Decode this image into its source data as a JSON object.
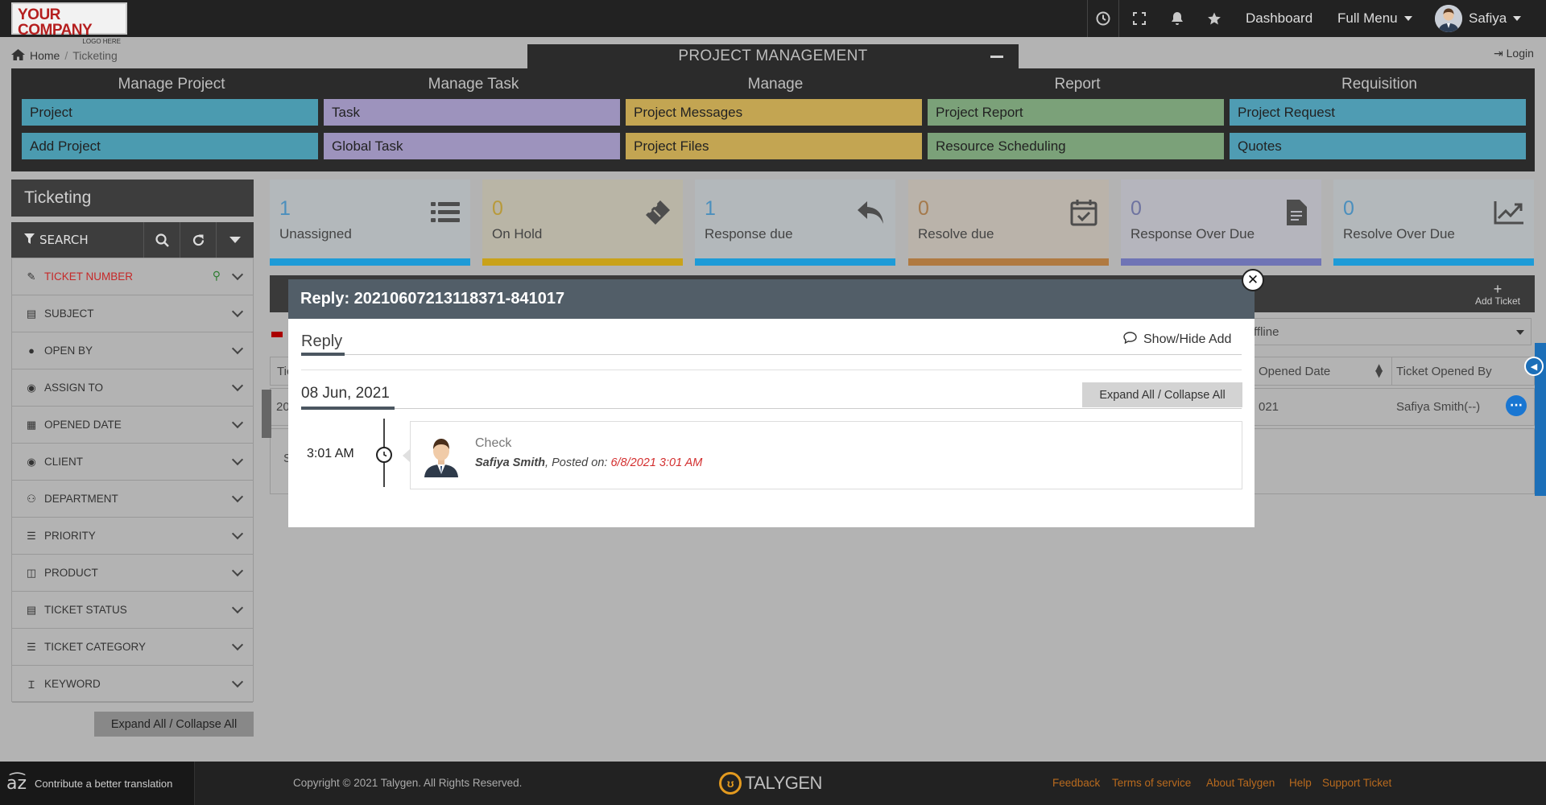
{
  "header": {
    "logo_line1": "YOUR COMPANY",
    "logo_line2": "LOGO HERE",
    "dashboard": "Dashboard",
    "full_menu": "Full Menu",
    "user_name": "Safiya"
  },
  "breadcrumb": {
    "home": "Home",
    "current": "Ticketing"
  },
  "login": "Login",
  "project_management": {
    "title": "PROJECT MANAGEMENT",
    "columns": [
      {
        "heading": "Manage Project",
        "color": "#4b9bb0",
        "items": [
          "Project",
          "Add Project"
        ]
      },
      {
        "heading": "Manage Task",
        "color": "#9d93bd",
        "items": [
          "Task",
          "Global Task"
        ]
      },
      {
        "heading": "Manage",
        "color": "#c3a552",
        "items": [
          "Project Messages",
          "Project Files"
        ]
      },
      {
        "heading": "Report",
        "color": "#7ba179",
        "items": [
          "Project Report",
          "Resource Scheduling"
        ]
      },
      {
        "heading": "Requisition",
        "color": "#4f9cb3",
        "items": [
          "Project Request",
          "Quotes"
        ]
      }
    ]
  },
  "sidebar": {
    "title": "Ticketing",
    "search_label": "SEARCH",
    "filters": [
      {
        "label": "TICKET NUMBER",
        "icon": "ticket-icon"
      },
      {
        "label": "SUBJECT",
        "icon": "document-icon"
      },
      {
        "label": "OPEN BY",
        "icon": "user-icon"
      },
      {
        "label": "ASSIGN TO",
        "icon": "user-circle-icon"
      },
      {
        "label": "OPENED DATE",
        "icon": "calendar-icon"
      },
      {
        "label": "CLIENT",
        "icon": "user-circle-icon"
      },
      {
        "label": "DEPARTMENT",
        "icon": "users-icon"
      },
      {
        "label": "PRIORITY",
        "icon": "list-icon"
      },
      {
        "label": "PRODUCT",
        "icon": "product-icon"
      },
      {
        "label": "TICKET STATUS",
        "icon": "document-icon"
      },
      {
        "label": "TICKET CATEGORY",
        "icon": "list-icon"
      },
      {
        "label": "KEYWORD",
        "icon": "text-icon"
      }
    ],
    "expand_collapse": "Expand All / Collapse All"
  },
  "stats": [
    {
      "value": "1",
      "label": "Unassigned",
      "color": "#4b8fbd",
      "bar": "#1e9bd7",
      "bg": "#b3b8bb",
      "icon": "list-icon"
    },
    {
      "value": "0",
      "label": "On Hold",
      "color": "#b89a3a",
      "bar": "#c9a21a",
      "bg": "#b9b5a6",
      "icon": "ticket-icon"
    },
    {
      "value": "1",
      "label": "Response due",
      "color": "#4b8fbd",
      "bar": "#1e9bd7",
      "bg": "#b3b8bb",
      "icon": "reply-icon"
    },
    {
      "value": "0",
      "label": "Resolve due",
      "color": "#a57a4c",
      "bar": "#b07a41",
      "bg": "#bab3aa",
      "icon": "calendar-check-icon"
    },
    {
      "value": "0",
      "label": "Response Over Due",
      "color": "#6e73a0",
      "bar": "#6f74b5",
      "bg": "#b5b5bd",
      "icon": "file-icon"
    },
    {
      "value": "0",
      "label": "Resolve Over Due",
      "color": "#4b8fbd",
      "bar": "#1e9bd7",
      "bg": "#b3b8bb",
      "icon": "chart-line-icon"
    }
  ],
  "background_table": {
    "add_ticket": "Add Ticket",
    "select_value": "ffline",
    "col_opened_date": "Opened Date",
    "col_opened_by": "Ticket Opened By",
    "row_date": "021",
    "row_opened_by": "Safiya Smith(--)",
    "row_prefix": "20",
    "col_prefix": "Tic",
    "foot_prefix": "S"
  },
  "modal": {
    "title": "Reply: 20210607213118371-841017",
    "reply_label": "Reply",
    "show_hide": "Show/Hide Add",
    "date": "08 Jun, 2021",
    "expand_collapse": "Expand All / Collapse All",
    "entry": {
      "time": "3:01 AM",
      "message": "Check",
      "author": "Safiya Smith",
      "posted_on_label": ", Posted on:",
      "posted_on": "6/8/2021 3:01 AM"
    }
  },
  "footer": {
    "translate": "Contribute a better translation",
    "copyright": "Copyright © 2021 Talygen. All Rights Reserved.",
    "brand": "TALYGEN",
    "links": [
      "Feedback",
      "Terms of service",
      "About Talygen",
      "Help",
      "Support Ticket"
    ]
  }
}
